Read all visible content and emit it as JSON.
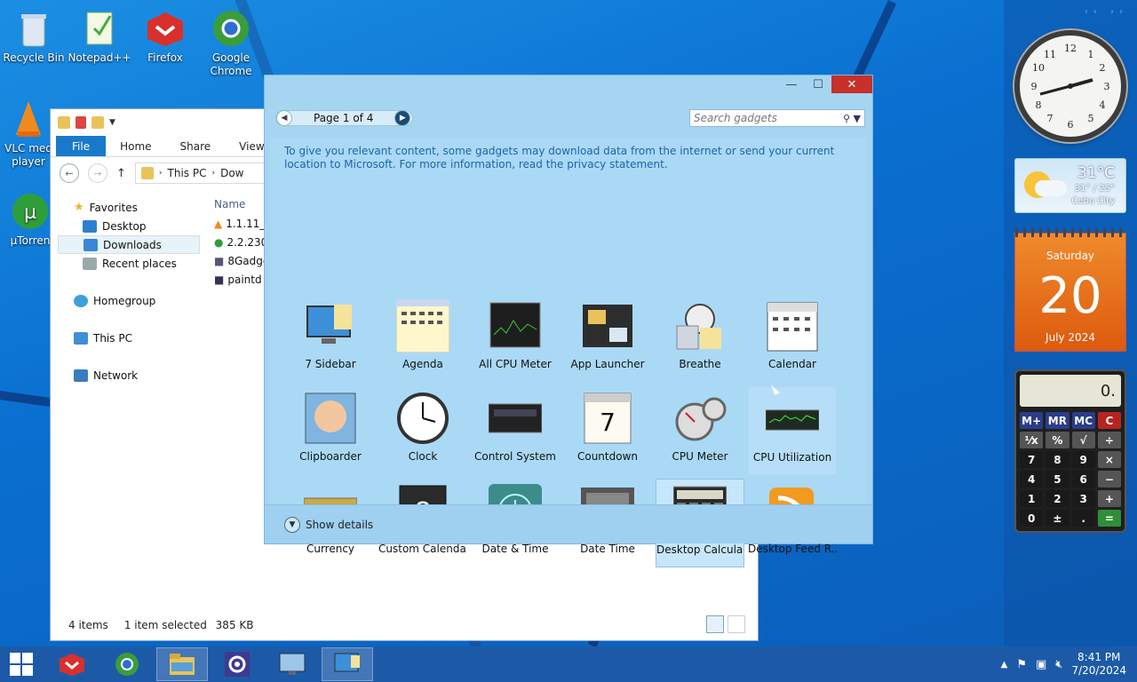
{
  "desktop_icons": [
    {
      "label": "Recycle Bin",
      "icon": "recycle-bin-icon"
    },
    {
      "label": "Notepad++",
      "icon": "notepad-plus-icon"
    },
    {
      "label": "Firefox",
      "icon": "firefox-icon"
    },
    {
      "label": "Google",
      "label2": "Chrome",
      "icon": "chrome-icon"
    },
    {
      "label": "VLC med",
      "label2": "player",
      "icon": "vlc-icon"
    },
    {
      "label": "µTorren",
      "icon": "utorrent-icon"
    }
  ],
  "explorer": {
    "ribbon_tabs": [
      "File",
      "Home",
      "Share",
      "View"
    ],
    "address": {
      "part1": "This PC",
      "part2": "Dow"
    },
    "nav": {
      "favorites": "Favorites",
      "desktop": "Desktop",
      "downloads": "Downloads",
      "recent": "Recent places",
      "homegroup": "Homegroup",
      "thispc": "This PC",
      "network": "Network"
    },
    "column_header": "Name",
    "files": [
      "1.1.11_",
      "2.2.230",
      "8Gadge",
      "paintd"
    ],
    "status": {
      "items": "4 items",
      "selected": "1 item selected",
      "size": "385 KB"
    }
  },
  "gadgets": {
    "page_label": "Page 1 of 4",
    "search_placeholder": "Search gadgets",
    "privacy_text": "To give you relevant content, some gadgets may download data from the internet or send your current location to Microsoft. For more information, read the privacy statement.",
    "items": [
      "7 Sidebar",
      "Agenda",
      "All CPU Meter",
      "App Launcher",
      "Breathe",
      "Calendar",
      "Clipboarder",
      "Clock",
      "Control System",
      "Countdown",
      "CPU Meter",
      "CPU Utilization",
      "Currency",
      "Custom Calendar",
      "Date & Time",
      "Date Time",
      "Desktop Calcula...",
      "Desktop Feed R..."
    ],
    "show_details": "Show details"
  },
  "sidebar": {
    "weather": {
      "temp": "31°C",
      "range": "31° / 25°",
      "city": "Cebu City"
    },
    "calendar": {
      "day": "Saturday",
      "date": "20",
      "month": "July 2024"
    },
    "calculator": {
      "display": "0.",
      "keys": [
        "M+",
        "MR",
        "MC",
        "C",
        "⅟x",
        "%",
        "√",
        "÷",
        "7",
        "8",
        "9",
        "×",
        "4",
        "5",
        "6",
        "−",
        "1",
        "2",
        "3",
        "+",
        "0",
        "±",
        ".",
        "="
      ]
    }
  },
  "taskbar": {
    "time": "8:41 PM",
    "date": "7/20/2024"
  },
  "colors": {
    "accent": "#1979ca",
    "close": "#c7302b",
    "calendar_orange": "#f08a2c"
  }
}
